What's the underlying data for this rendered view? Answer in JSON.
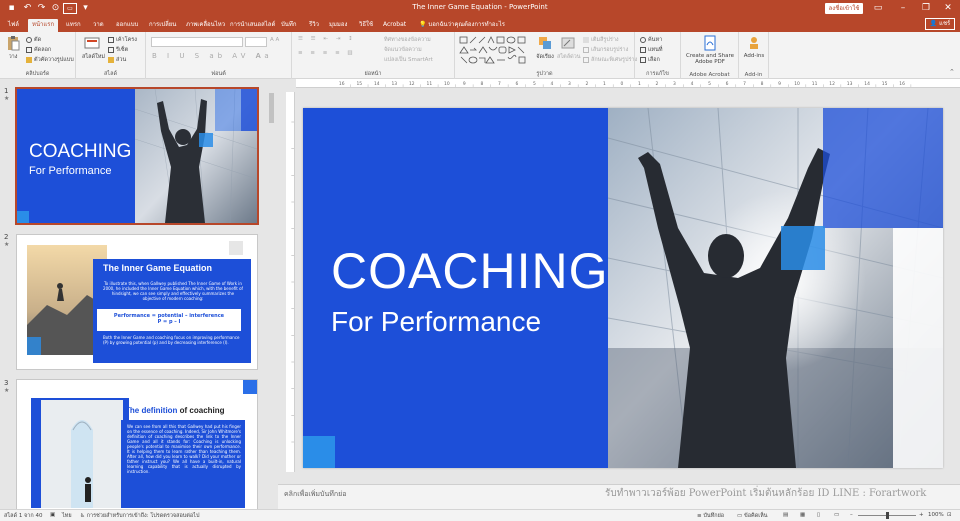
{
  "window": {
    "title": "The Inner Game Equation  -  PowerPoint",
    "signin": "ลงชื่อเข้าใช้",
    "share": "แชร์",
    "colors": {
      "brand": "#b7472a",
      "slide_blue": "#1d4fd8",
      "accent_blue": "#2a8de8"
    }
  },
  "tabs": [
    "ไฟล์",
    "หน้าแรก",
    "แทรก",
    "วาด",
    "ออกแบบ",
    "การเปลี่ยน",
    "ภาพเคลื่อนไหว",
    "การนำเสนอสไลด์",
    "บันทึก",
    "รีวิว",
    "มุมมอง",
    "วิธีใช้",
    "Acrobat"
  ],
  "tell_me": "บอกฉันว่าคุณต้องการทำอะไร",
  "ribbon": {
    "clipboard": {
      "paste": "วาง",
      "cut": "ตัด",
      "copy": "คัดลอก",
      "format_painter": "ตัวคัดวางรูปแบบ",
      "label": "คลิปบอร์ด"
    },
    "slides": {
      "new_slide": "สไลด์ใหม่",
      "layout": "เค้าโครง",
      "reset": "รีเซ็ต",
      "section": "ส่วน",
      "label": "สไลด์"
    },
    "font": {
      "label": "ฟอนต์"
    },
    "paragraph": {
      "direction": "ทิศทางของข้อความ",
      "align": "จัดแนวข้อความ",
      "smartart": "แปลงเป็น SmartArt",
      "label": "ย่อหน้า"
    },
    "drawing": {
      "arrange": "จัดเรียง",
      "quick_styles": "สไตล์ด่วน",
      "fill": "เติมสีรูปร่าง",
      "outline": "เส้นกรอบรูปร่าง",
      "effects": "ลักษณะพิเศษรูปร่าง",
      "label": "รูปวาด"
    },
    "editing": {
      "find": "ค้นหา",
      "replace": "แทนที่",
      "select": "เลือก",
      "label": "การแก้ไข"
    },
    "acrobat": {
      "create": "Create and Share",
      "create2": "Adobe PDF",
      "label": "Adobe Acrobat"
    },
    "addins": {
      "addins": "Add-ins",
      "label": "Add-in"
    }
  },
  "thumbnails": [
    {
      "num": "1",
      "star": "★",
      "title": "COACHING",
      "subtitle": "For Performance"
    },
    {
      "num": "2",
      "star": "★",
      "title": "The Inner Game Equation",
      "body": "To illustrate this, when Gallwey published The Inner Game of Work in 2000, he included the Inner Game Equation which, with the benefit of hindsight, we can see simply and effectively summarizes the objective of modern coaching:",
      "eq1": "Performance = potential – interference",
      "eq2": "P = p – I",
      "body2": "Both the Inner Game and coaching focus on improving performance (P) by growing potential (p) and by decreasing interference (I)."
    },
    {
      "num": "3",
      "star": "★",
      "title_a": "The definition",
      "title_b": " of coaching",
      "body": "We can see from all this that Gallwey had put his finger on the essence of coaching. Indeed, Sir John Whitmore's definition of coaching describes the link to the Inner Game and all it stands for: Coaching is unlocking people's potential to maximise their own performance. It is helping them to learn rather than teaching them. After all, how did you learn to walk? Did your mother or father instruct you? We all have a built-in, natural learning capability that is actually disrupted by instruction."
    }
  ],
  "main_slide": {
    "title": "COACHING",
    "subtitle": "For Performance"
  },
  "notes_placeholder": "คลิกเพื่อเพิ่มบันทึกย่อ",
  "watermark": "รับทำพาวเวอร์พ้อย PowerPoint เริ่มต้นหลักร้อย ID LINE : Forartwork",
  "status": {
    "slide_of": "สไลด์ 1 จาก 40",
    "lang": "ไทย",
    "accessibility": "การช่วยสำหรับการเข้าถึง: โปรดตรวจสอบต่อไป",
    "notes": "บันทึกย่อ",
    "comments": "ข้อคิดเห็น",
    "zoom": "100%"
  },
  "ruler_labels": [
    "16",
    "15",
    "14",
    "13",
    "12",
    "11",
    "10",
    "9",
    "8",
    "7",
    "6",
    "5",
    "4",
    "3",
    "2",
    "1",
    "0",
    "1",
    "2",
    "3",
    "4",
    "5",
    "6",
    "7",
    "8",
    "9",
    "10",
    "11",
    "12",
    "13",
    "14",
    "15",
    "16"
  ]
}
